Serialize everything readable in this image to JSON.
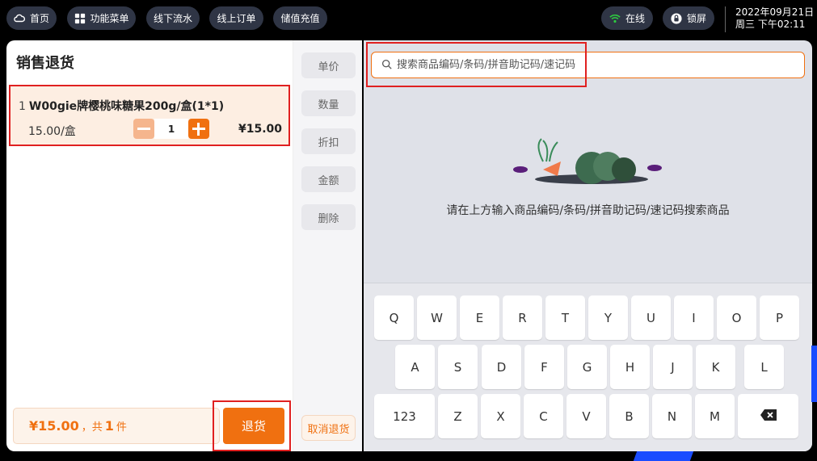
{
  "topbar": {
    "home": "首页",
    "menu": "功能菜单",
    "offline_flow": "线下流水",
    "online_orders": "线上订单",
    "recharge": "储值充值",
    "online_status": "在线",
    "lock": "锁屏",
    "date": "2022年09月21日",
    "time": "周三 下午02:11"
  },
  "left": {
    "title": "销售退货",
    "item": {
      "index": "1",
      "name": "W00gie牌樱桃味糖果200g/盒(1*1)",
      "unit_price": "15.00/盒",
      "qty": "1",
      "total": "¥15.00"
    },
    "summary": {
      "amount": "¥15.00",
      "sep": "，共",
      "count": "1",
      "unit": "件"
    },
    "return_button": "退货"
  },
  "middle": {
    "unit_price": "单价",
    "quantity": "数量",
    "discount": "折扣",
    "amount": "金额",
    "delete": "删除",
    "cancel_return": "取消退货"
  },
  "right": {
    "search_placeholder": "搜索商品编码/条码/拼音助记码/速记码",
    "empty_hint": "请在上方输入商品编码/条码/拼音助记码/速记码搜索商品"
  },
  "keyboard": {
    "row1": [
      "Q",
      "W",
      "E",
      "R",
      "T",
      "Y",
      "U",
      "I",
      "O",
      "P"
    ],
    "row2": [
      "A",
      "S",
      "D",
      "F",
      "G",
      "H",
      "J",
      "K",
      "L"
    ],
    "row3": [
      "123",
      "Z",
      "X",
      "C",
      "V",
      "B",
      "N",
      "M"
    ]
  },
  "colors": {
    "accent": "#f07010",
    "highlight_border": "#e02020",
    "topbar_button": "#2f3545"
  }
}
